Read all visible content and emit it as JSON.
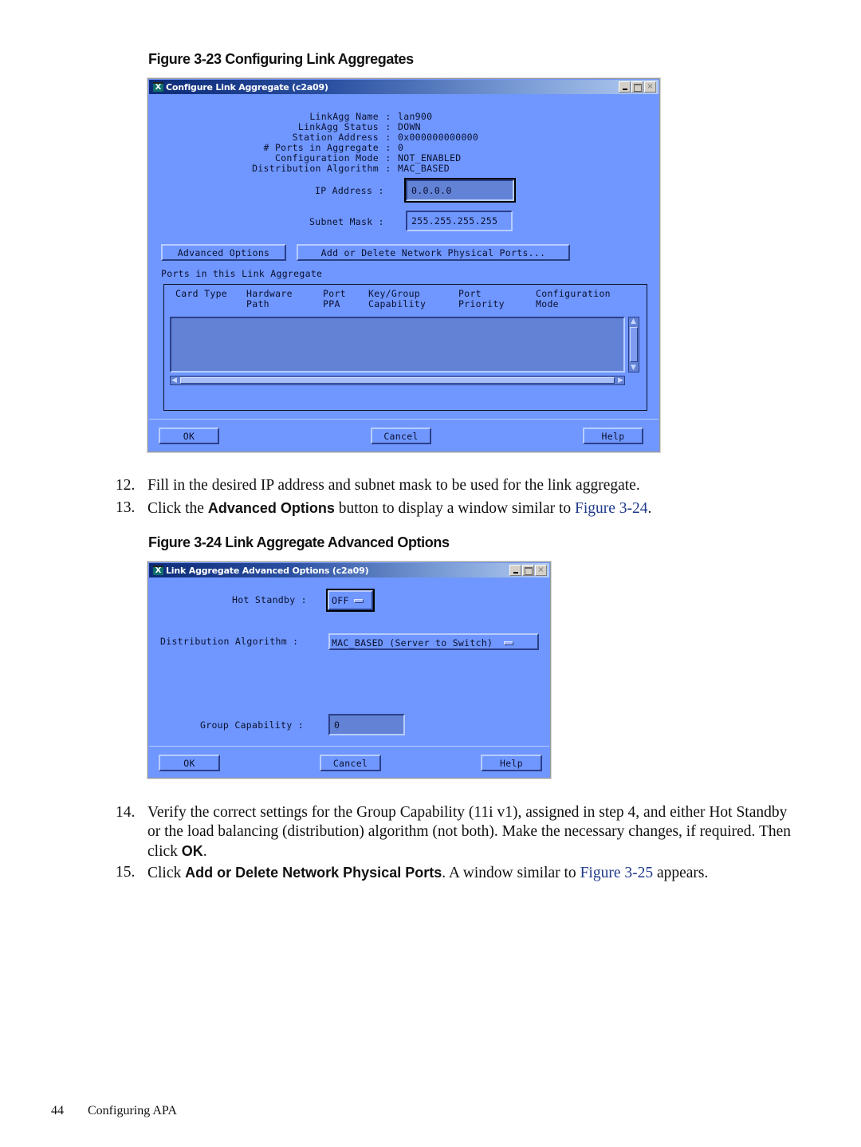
{
  "figure1": {
    "caption_number": "Figure 3-23",
    "caption_title": "Configuring Link Aggregates",
    "window": {
      "title": "Configure Link Aggregate (c2a09)",
      "app_icon": "X",
      "controls": {
        "minimize": "minimize-icon",
        "maximize": "maximize-icon",
        "close": "×"
      }
    },
    "info": [
      {
        "label": "LinkAgg Name",
        "value": "lan900"
      },
      {
        "label": "LinkAgg Status",
        "value": "DOWN"
      },
      {
        "label": "Station Address",
        "value": "0x000000000000"
      },
      {
        "label": "# Ports in Aggregate",
        "value": "0"
      },
      {
        "label": "Configuration Mode",
        "value": "NOT_ENABLED"
      },
      {
        "label": "Distribution Algorithm",
        "value": "MAC_BASED"
      }
    ],
    "ip_address": {
      "label": "IP Address :",
      "value": "0.0.0.0"
    },
    "subnet_mask": {
      "label": "Subnet Mask :",
      "value": "255.255.255.255"
    },
    "buttons": {
      "advanced_options": "Advanced Options",
      "add_delete_ports": "Add or Delete Network Physical Ports...",
      "ok": "OK",
      "cancel": "Cancel",
      "help": "Help"
    },
    "ports_section_label": "Ports in this Link Aggregate",
    "columns": [
      {
        "line1": "Card Type",
        "line2": ""
      },
      {
        "line1": "Hardware",
        "line2": "Path"
      },
      {
        "line1": "Port",
        "line2": "PPA"
      },
      {
        "line1": "Key/Group",
        "line2": "Capability"
      },
      {
        "line1": "Port",
        "line2": "Priority"
      },
      {
        "line1": "Configuration",
        "line2": "Mode"
      }
    ],
    "rows": []
  },
  "steps_a": [
    {
      "num": "12.",
      "parts": [
        {
          "t": "Fill in the desired IP address and subnet mask to be used for the link aggregate."
        }
      ]
    },
    {
      "num": "13.",
      "parts": [
        {
          "t": "Click the "
        },
        {
          "b": "Advanced Options"
        },
        {
          "t": " button to display a window similar to "
        },
        {
          "link": "Figure 3-24"
        },
        {
          "t": "."
        }
      ]
    }
  ],
  "figure2": {
    "caption_number": "Figure 3-24",
    "caption_title": "Link Aggregate Advanced Options",
    "window": {
      "title": "Link Aggregate Advanced Options (c2a09)",
      "app_icon": "X",
      "controls": {
        "minimize": "minimize-icon",
        "maximize": "maximize-icon",
        "close": "×"
      }
    },
    "hot_standby": {
      "label": "Hot Standby :",
      "value": "OFF"
    },
    "distribution_algorithm": {
      "label": "Distribution Algorithm :",
      "value": "MAC_BASED (Server to Switch)"
    },
    "group_capability": {
      "label": "Group Capability :",
      "value": "0"
    },
    "buttons": {
      "ok": "OK",
      "cancel": "Cancel",
      "help": "Help"
    }
  },
  "steps_b": [
    {
      "num": "14.",
      "parts": [
        {
          "t": "Verify the correct settings for the Group Capability (11i v1), assigned in step 4, and either Hot Standby or the load balancing (distribution) algorithm (not both). Make the necessary changes, if required. Then click "
        },
        {
          "b": "OK"
        },
        {
          "t": "."
        }
      ]
    },
    {
      "num": "15.",
      "parts": [
        {
          "t": "Click "
        },
        {
          "b": "Add or Delete Network Physical Ports"
        },
        {
          "t": ". A window similar to "
        },
        {
          "link": "Figure 3-25"
        },
        {
          "t": " appears."
        }
      ]
    }
  ],
  "footer": {
    "page_number": "44",
    "section": "Configuring APA"
  },
  "colors": {
    "window_bg": "#6f97ff",
    "field_bg": "#6282d6",
    "link": "#1f3a8a",
    "titlebar_dark": "#0c2a76"
  }
}
